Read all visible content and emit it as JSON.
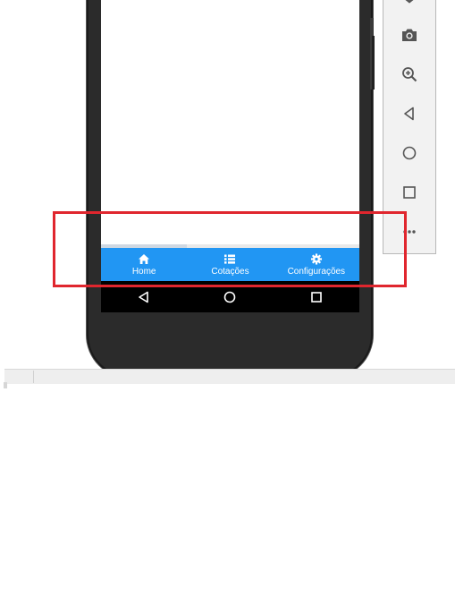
{
  "bottom_nav": {
    "items": [
      {
        "label": "Home",
        "icon": "home-icon"
      },
      {
        "label": "Cotações",
        "icon": "list-icon"
      },
      {
        "label": "Configurações",
        "icon": "gear-icon"
      }
    ],
    "background": "#2196f3"
  },
  "android_nav": {
    "buttons": [
      "back-icon",
      "home-circle-icon",
      "recents-icon"
    ]
  },
  "emulator_toolbar": {
    "buttons": [
      "camera-icon",
      "zoom-icon",
      "rotate-back-icon",
      "circle-icon",
      "square-icon",
      "more-icon"
    ]
  },
  "highlight_color": "#e0262e"
}
